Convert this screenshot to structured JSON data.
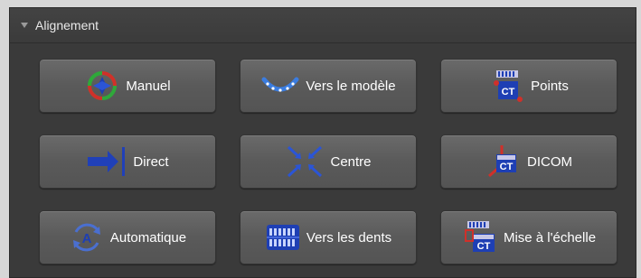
{
  "panel": {
    "title": "Alignement"
  },
  "buttons": [
    {
      "label": "Manuel",
      "icon": "manual-align-icon"
    },
    {
      "label": "Vers le modèle",
      "icon": "model-align-icon"
    },
    {
      "label": "Points",
      "icon": "points-align-icon"
    },
    {
      "label": "Direct",
      "icon": "direct-align-icon"
    },
    {
      "label": "Centre",
      "icon": "center-align-icon"
    },
    {
      "label": "DICOM",
      "icon": "dicom-align-icon"
    },
    {
      "label": "Automatique",
      "icon": "automatic-align-icon"
    },
    {
      "label": "Vers les dents",
      "icon": "teeth-align-icon"
    },
    {
      "label": "Mise à l'échelle",
      "icon": "scale-align-icon"
    }
  ],
  "colors": {
    "panel_bg": "#3a3a3a",
    "button_bg": "#5f5f5f",
    "icon_blue": "#1e3fb4",
    "icon_red": "#d0302a",
    "icon_green": "#2fa83a"
  }
}
